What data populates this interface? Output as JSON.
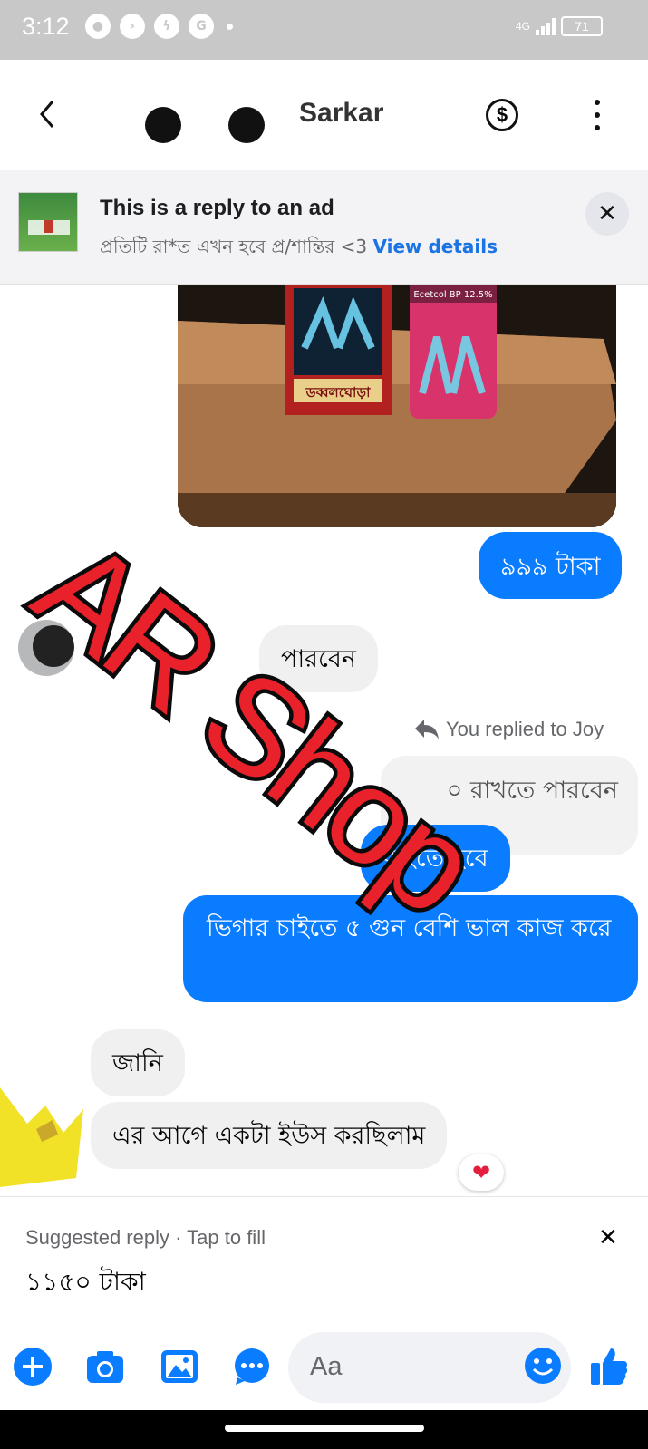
{
  "status": {
    "time": "3:12",
    "network": "4G",
    "battery": "71"
  },
  "header": {
    "contact_name": "Sarkar"
  },
  "ad_banner": {
    "title": "This is a reply to an ad",
    "subtitle": "প্রতিটি রা*ত এখন হবে প্র/শান্তির <3",
    "link": "View details",
    "close": "✕"
  },
  "messages": [
    {
      "dir": "out",
      "text": "৯৯৯ টাকা"
    },
    {
      "dir": "in",
      "text": "পারবেন"
    },
    {
      "dir": "note",
      "text": "You replied to Joy"
    },
    {
      "dir": "quoted",
      "text": "০ রাখতে পারবেন"
    },
    {
      "dir": "out",
      "text": "বাইতে হবে"
    },
    {
      "dir": "out",
      "text": "ভিগার চাইতে ৫ গুন বেশি ভাল কাজ করে"
    },
    {
      "dir": "in",
      "text": "জানি"
    },
    {
      "dir": "in",
      "text": "এর আগে একটা ইউস করছিলাম"
    }
  ],
  "reaction": "❤",
  "watermark": "AR Shop",
  "product_labels": {
    "box": "ডব্বলঘোড়া",
    "can": "Ecetcol BP 12.5%"
  },
  "suggested_reply": {
    "header": "Suggested reply · Tap to fill",
    "value": "১১৫০ টাকা",
    "close": "✕"
  },
  "composer": {
    "placeholder": "Aa"
  },
  "colors": {
    "accent": "#0a7cff",
    "incoming": "#f0f0f0",
    "watermark_red": "#e8212b"
  }
}
